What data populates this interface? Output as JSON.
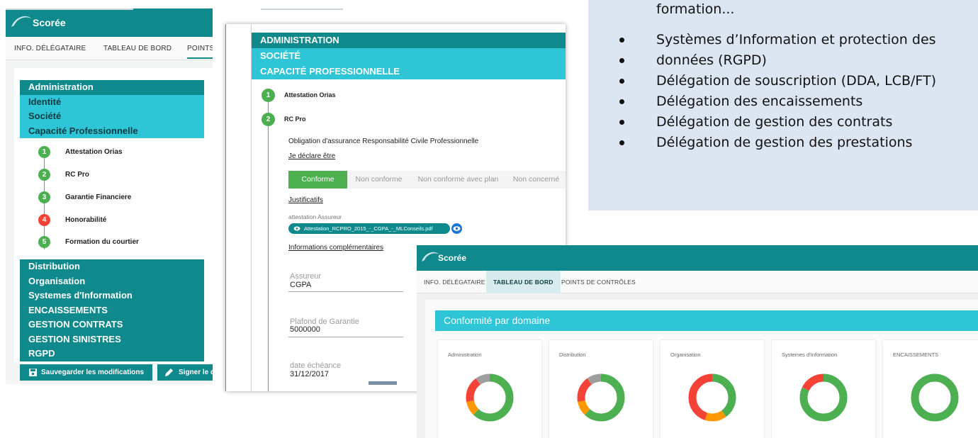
{
  "infobox": {
    "first_line": "formation...",
    "bullets": [
      "Systèmes d’Information et protection des",
      "données  (RGPD)",
      "Délégation de souscription (DDA, LCB/FT)",
      "Délégation des encaissements",
      "Délégation de gestion des contrats",
      "Délégation de gestion des prestations"
    ]
  },
  "screen1": {
    "brand": "Scorée",
    "tabs": [
      "INFO. DÉLÉGATAIRE",
      "TABLEAU DE BORD",
      "POINTS"
    ],
    "nav_top": [
      "Administration",
      "Identité",
      "Société",
      "Capacité Professionnelle"
    ],
    "steps": [
      {
        "num": "1",
        "label": "Attestation Orias",
        "status": "green"
      },
      {
        "num": "2",
        "label": "RC Pro",
        "status": "green"
      },
      {
        "num": "3",
        "label": "Garantie Financiere",
        "status": "green"
      },
      {
        "num": "4",
        "label": "Honorabilité",
        "status": "red"
      },
      {
        "num": "5",
        "label": "Formation du courtier",
        "status": "green"
      }
    ],
    "nav_bottom": [
      "Distribution",
      "Organisation",
      "Systemes d'Information",
      "ENCAISSEMENTS",
      "GESTION CONTRATS",
      "GESTION SINISTRES",
      "RGPD"
    ],
    "save_label": "Sauvegarder les modifications",
    "sign_label": "Signer le d"
  },
  "screen2": {
    "bars": [
      "ADMINISTRATION",
      "SOCIÉTÉ",
      "CAPACITÉ PROFESSIONNELLE"
    ],
    "steps": [
      {
        "num": "1",
        "label": "Attestation Orias"
      },
      {
        "num": "2",
        "label": "RC Pro"
      }
    ],
    "obligation": "Obligation d'assurance Responsabilité Civile Professionnelle",
    "declare": "Je déclare être",
    "segments": [
      "Conforme",
      "Non conforme",
      "Non conforme avec plan",
      "Non concerné"
    ],
    "justificatifs": "Justificatifs",
    "attestation_label": "attestation Assureur",
    "file_name": "Attestation_RCPRO_2015_-_CGPA_-_MLConseils.pdf",
    "infos": "Informations complémentaires",
    "fields": [
      {
        "label": "Assureur",
        "value": "CGPA"
      },
      {
        "label": "Plafond de Garantie",
        "value": "5000000"
      },
      {
        "label": "date échéance",
        "value": "31/12/2017"
      }
    ]
  },
  "screen3": {
    "brand": "Scorée",
    "tabs": [
      "INFO. DÉLÉGATAIRE",
      "TABLEAU DE BORD",
      "POINTS DE CONTRÔLES"
    ],
    "banner": "Conformité par domaine",
    "cards": [
      {
        "title": "Administration",
        "segments": [
          {
            "color": "#4caf50",
            "value": 62
          },
          {
            "color": "#ff9800",
            "value": 10
          },
          {
            "color": "#f44336",
            "value": 18
          },
          {
            "color": "#9e9e9e",
            "value": 10
          }
        ]
      },
      {
        "title": "Distribution",
        "segments": [
          {
            "color": "#4caf50",
            "value": 62
          },
          {
            "color": "#ff9800",
            "value": 10
          },
          {
            "color": "#f44336",
            "value": 18
          },
          {
            "color": "#9e9e9e",
            "value": 10
          }
        ]
      },
      {
        "title": "Organisation",
        "segments": [
          {
            "color": "#4caf50",
            "value": 40
          },
          {
            "color": "#ff9800",
            "value": 15
          },
          {
            "color": "#f44336",
            "value": 45
          }
        ]
      },
      {
        "title": "Systemes d'Information",
        "segments": [
          {
            "color": "#4caf50",
            "value": 82
          },
          {
            "color": "#f44336",
            "value": 18
          }
        ]
      },
      {
        "title": "ENCAISSEMENTS",
        "segments": [
          {
            "color": "#4caf50",
            "value": 100
          }
        ]
      }
    ]
  },
  "colors": {
    "teal_dark": "#10898c",
    "teal_light": "#2ec5d6",
    "green": "#4caf50",
    "red": "#f44336",
    "orange": "#ff9800",
    "grey": "#9e9e9e"
  }
}
